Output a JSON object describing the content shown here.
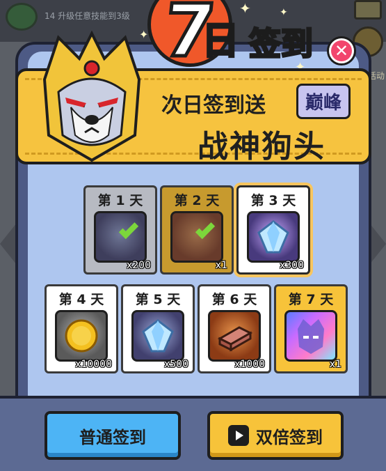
{
  "background": {
    "quest_text": "14 升级任意技能到3级",
    "right_label": "活动"
  },
  "title": {
    "number": "7",
    "ri": "日",
    "qiandao": "签到"
  },
  "close": {
    "label": "✕"
  },
  "banner": {
    "line1": "次日签到送",
    "peak_tag": "巅峰",
    "line2": "战神狗头"
  },
  "rewards": [
    {
      "day": "第 1 天",
      "qty": "x200",
      "status": "claimed",
      "icon": "gem-icon"
    },
    {
      "day": "第 2 天",
      "qty": "x1",
      "status": "claimed",
      "icon": "dog-head-icon"
    },
    {
      "day": "第 3 天",
      "qty": "x300",
      "status": "current",
      "icon": "gem-icon"
    },
    {
      "day": "第 4 天",
      "qty": "x10000",
      "status": "normal",
      "icon": "gold-coin-icon"
    },
    {
      "day": "第 5 天",
      "qty": "x500",
      "status": "normal",
      "icon": "gem-icon"
    },
    {
      "day": "第 6 天",
      "qty": "x1000",
      "status": "normal",
      "icon": "brick-icon"
    },
    {
      "day": "第 7 天",
      "qty": "x1",
      "status": "special",
      "icon": "dog-head-icon"
    }
  ],
  "buttons": {
    "normal_checkin": "普通签到",
    "double_checkin": "双倍签到"
  },
  "colors": {
    "panel": "#4d5a85",
    "inner": "#aec6ef",
    "banner": "#f6c33f",
    "normal_button": "#4db4f5",
    "double_button": "#f7c33a",
    "close": "#f2456d"
  }
}
